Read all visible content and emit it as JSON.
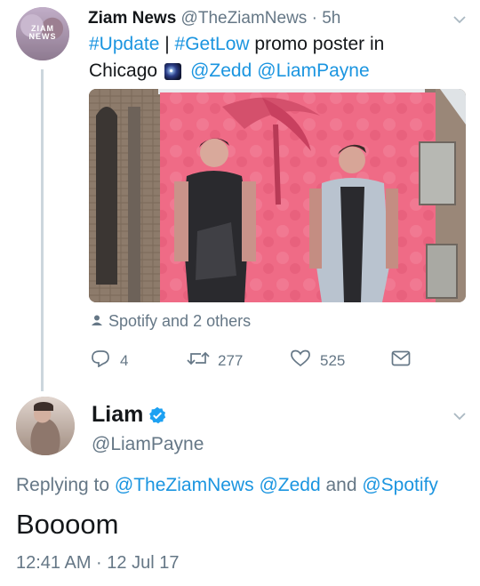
{
  "tweet1": {
    "author_name": "Ziam News",
    "author_handle": "@TheZiamNews",
    "dot": "·",
    "time": "5h",
    "avatar_text": "ZIAM NEWS",
    "text": {
      "hashtag1": "#Update",
      "separator": " | ",
      "hashtag2": "#GetLow",
      "plain1": " promo poster in",
      "plain2": "Chicago",
      "mention1": "@Zedd",
      "mention2": "@LiamPayne"
    },
    "tagged": "Spotify and 2 others",
    "actions": {
      "replies": "4",
      "retweets": "277",
      "likes": "525"
    }
  },
  "tweet2": {
    "author_name": "Liam",
    "author_handle": "@LiamPayne",
    "replying_prefix": "Replying to",
    "reply_mention1": "@TheZiamNews",
    "reply_mention2": "@Zedd",
    "reply_and": "and",
    "reply_mention3": "@Spotify",
    "text": "Boooom",
    "timestamp": "12:41 AM · 12 Jul 17"
  },
  "colors": {
    "link": "#1b95e0",
    "secondary": "#657786",
    "verified": "#1da1f2",
    "thread_line": "#ccd6dd",
    "poster_pink": "#e8607e"
  },
  "icons": [
    "chevron-down-icon",
    "galaxy-emoji-icon",
    "person-tag-icon",
    "reply-icon",
    "retweet-icon",
    "heart-icon",
    "message-icon",
    "verified-badge-icon"
  ]
}
